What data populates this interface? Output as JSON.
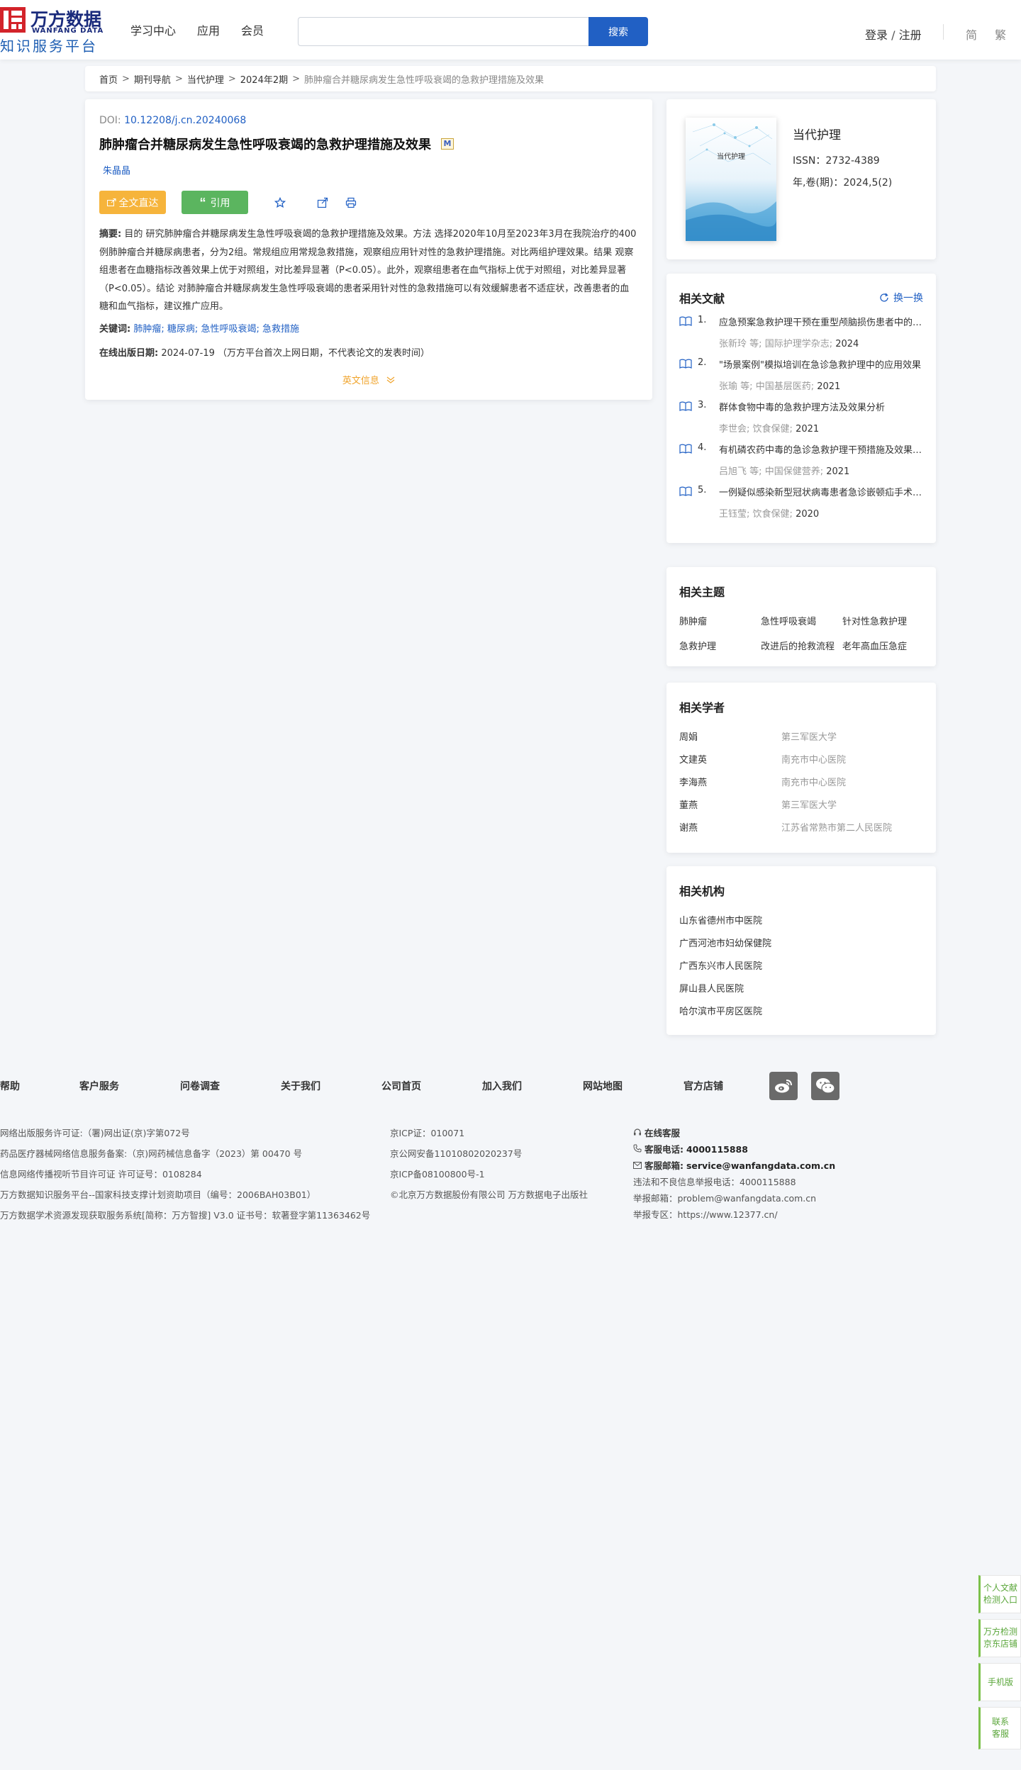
{
  "header": {
    "logo_cn": "万方数据",
    "logo_en": "WANFANG DATA",
    "logo_sub": "知识服务平台",
    "nav": [
      "学习中心",
      "应用",
      "会员"
    ],
    "search_placeholder": "",
    "search_button": "搜索",
    "login": "登录",
    "login_sep": "/",
    "register": "注册",
    "lang_simplified": "简",
    "lang_traditional": "繁"
  },
  "breadcrumb": {
    "items": [
      "首页",
      "期刊导航",
      "当代护理",
      "2024年2期"
    ],
    "separator": ">",
    "current": "肺肿瘤合并糖尿病发生急性呼吸衰竭的急救护理措施及效果"
  },
  "article": {
    "doi_label": "DOI:",
    "doi_value": "10.12208/j.cn.20240068",
    "title": "肺肿瘤合并糖尿病发生急性呼吸衰竭的急救护理措施及效果",
    "m_badge": "M",
    "author": "朱晶晶",
    "btn_fulltext": "全文直达",
    "btn_cite": "引用",
    "abstract_label": "摘要:",
    "abstract_text": "目的 研究肺肿瘤合并糖尿病发生急性呼吸衰竭的急救护理措施及效果。方法 选择2020年10月至2023年3月在我院治疗的400例肺肿瘤合并糖尿病患者，分为2组。常规组应用常规急救措施，观察组应用针对性的急救护理措施。对比两组护理效果。结果 观察组患者在血糖指标改善效果上优于对照组，对比差异显著（P<0.05）。此外，观察组患者在血气指标上优于对照组，对比差异显著（P<0.05）。结论 对肺肿瘤合并糖尿病发生急性呼吸衰竭的患者采用针对性的急救措施可以有效缓解患者不适症状，改善患者的血糖和血气指标，建议推广应用。",
    "keywords_label": "关键词:",
    "keywords": [
      "肺肿瘤",
      "糖尿病",
      "急性呼吸衰竭",
      "急救措施"
    ],
    "keyword_sep": ";",
    "online_date_label": "在线出版日期:",
    "online_date": "2024-07-19",
    "online_date_note": "（万方平台首次上网日期，不代表论文的发表时间）",
    "en_info": "英文信息"
  },
  "journal": {
    "cover_title": "当代护理",
    "name": "当代护理",
    "issn": "ISSN：2732-4389",
    "volume": "年,卷(期)：2024,5(2)"
  },
  "related_docs": {
    "heading": "相关文献",
    "refresh": "换一换",
    "items": [
      {
        "num": "1.",
        "title": "应急预案急救护理干预在重型颅脑损伤患者中的应用效果",
        "author": "张新玲",
        "etal": "等;",
        "source": "国际护理学杂志",
        "year": "2024"
      },
      {
        "num": "2.",
        "title": "\"场景案例\"模拟培训在急诊急救护理中的应用效果",
        "author": "张瑜",
        "etal": "等;",
        "source": "中国基层医药",
        "year": "2021"
      },
      {
        "num": "3.",
        "title": "群体食物中毒的急救护理方法及效果分析",
        "author": "李世会",
        "etal": "",
        "source": "饮食保健",
        "year": "2021"
      },
      {
        "num": "4.",
        "title": "有机磷农药中毒的急诊急救护理干预措施及效果观察",
        "author": "吕旭飞",
        "etal": "等;",
        "source": "中国保健营养",
        "year": "2021"
      },
      {
        "num": "5.",
        "title": "一例疑似感染新型冠状病毒患者急诊嵌顿疝手术的护理",
        "author": "王钰莹",
        "etal": "",
        "source": "饮食保健",
        "year": "2020"
      }
    ]
  },
  "topics": {
    "heading": "相关主题",
    "items": [
      "肺肿瘤",
      "急性呼吸衰竭",
      "针对性急救护理",
      "急救护理",
      "改进后的抢救流程",
      "老年高血压急症"
    ]
  },
  "scholars": {
    "heading": "相关学者",
    "items": [
      {
        "name": "周娟",
        "org": "第三军医大学"
      },
      {
        "name": "文建英",
        "org": "南充市中心医院"
      },
      {
        "name": "李海燕",
        "org": "南充市中心医院"
      },
      {
        "name": "董燕",
        "org": "第三军医大学"
      },
      {
        "name": "谢燕",
        "org": "江苏省常熟市第二人民医院"
      }
    ]
  },
  "institutions": {
    "heading": "相关机构",
    "items": [
      "山东省德州市中医院",
      "广西河池市妇幼保健院",
      "广西东兴市人民医院",
      "屏山县人民医院",
      "哈尔滨市平房区医院"
    ]
  },
  "footer": {
    "links": [
      "帮助",
      "客户服务",
      "问卷调查",
      "关于我们",
      "公司首页",
      "加入我们",
      "网站地图",
      "官方店铺"
    ],
    "col1": [
      "网络出版服务许可证:（署)网出证(京)字第072号",
      "药品医疗器械网络信息服务备案:（京)网药械信息备字（2023）第 00470 号",
      "信息网络传播视听节目许可证 许可证号：0108284",
      "万方数据知识服务平台--国家科技支撑计划资助项目（编号：2006BAH03B01）",
      "万方数据学术资源发现获取服务系统[简称：万方智搜] V3.0 证书号：软著登字第11363462号"
    ],
    "col2": [
      "京ICP证：010071",
      "京公网安备11010802020237号",
      "京ICP备08100800号-1",
      "©北京万方数据股份有限公司 万方数据电子出版社"
    ],
    "online_service": "在线客服",
    "phone_label": "客服电话:",
    "phone": "4000115888",
    "email_label": "客服邮箱:",
    "email": "service@wanfangdata.com.cn",
    "report_phone": "违法和不良信息举报电话：4000115888",
    "report_email": "举报邮箱：problem@wanfangdata.com.cn",
    "report_zone": "举报专区：https://www.12377.cn/"
  },
  "side_float": {
    "items": [
      "个人文献检测入口",
      "万方检测京东店铺",
      "手机版",
      "联系客服"
    ]
  }
}
